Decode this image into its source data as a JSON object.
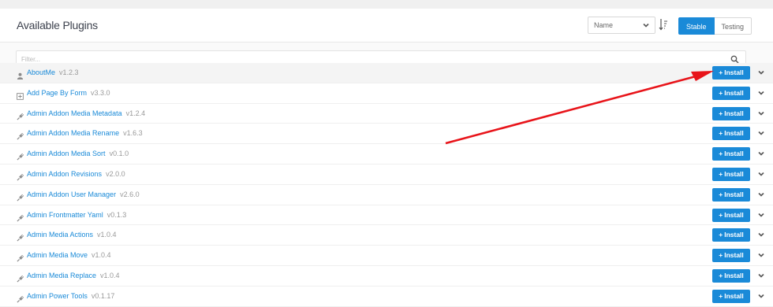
{
  "header": {
    "title": "Available Plugins",
    "sort_value": "Name",
    "sort_options": [
      "Name"
    ],
    "channel_tabs": [
      {
        "label": "Stable",
        "active": true
      },
      {
        "label": "Testing",
        "active": false
      }
    ]
  },
  "filter": {
    "placeholder": "Filter..."
  },
  "install_label": "Install",
  "colors": {
    "accent": "#1a8ad8",
    "arrow": "#e8141a"
  },
  "plugins": [
    {
      "name": "AboutMe",
      "version": "v1.2.3",
      "icon": "user-icon"
    },
    {
      "name": "Add Page By Form",
      "version": "v3.3.0",
      "icon": "plus-square-icon"
    },
    {
      "name": "Admin Addon Media Metadata",
      "version": "v1.2.4",
      "icon": "plug-icon"
    },
    {
      "name": "Admin Addon Media Rename",
      "version": "v1.6.3",
      "icon": "plug-icon"
    },
    {
      "name": "Admin Addon Media Sort",
      "version": "v0.1.0",
      "icon": "plug-icon"
    },
    {
      "name": "Admin Addon Revisions",
      "version": "v2.0.0",
      "icon": "plug-icon"
    },
    {
      "name": "Admin Addon User Manager",
      "version": "v2.6.0",
      "icon": "plug-icon"
    },
    {
      "name": "Admin Frontmatter Yaml",
      "version": "v0.1.3",
      "icon": "plug-icon"
    },
    {
      "name": "Admin Media Actions",
      "version": "v1.0.4",
      "icon": "plug-icon"
    },
    {
      "name": "Admin Media Move",
      "version": "v1.0.4",
      "icon": "plug-icon"
    },
    {
      "name": "Admin Media Replace",
      "version": "v1.0.4",
      "icon": "plug-icon"
    },
    {
      "name": "Admin Power Tools",
      "version": "v0.1.17",
      "icon": "plug-icon"
    }
  ]
}
